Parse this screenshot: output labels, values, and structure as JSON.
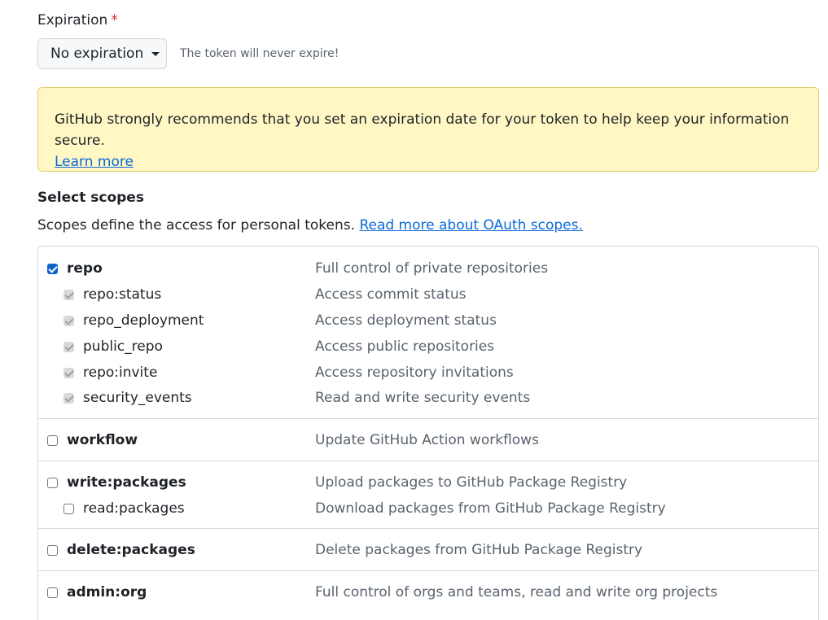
{
  "expiration": {
    "label": "Expiration",
    "required_mark": "*",
    "selected": "No expiration",
    "note": "The token will never expire!"
  },
  "flash": {
    "message": "GitHub strongly recommends that you set an expiration date for your token to help keep your information secure.",
    "link": "Learn more"
  },
  "scopes": {
    "title": "Select scopes",
    "description": "Scopes define the access for personal tokens.",
    "link": "Read more about OAuth scopes.",
    "items": [
      {
        "name": "repo",
        "desc": "Full control of private repositories",
        "checked": true
      },
      {
        "name": "repo:status",
        "desc": "Access commit status",
        "checked": true
      },
      {
        "name": "repo_deployment",
        "desc": "Access deployment status",
        "checked": true
      },
      {
        "name": "public_repo",
        "desc": "Access public repositories",
        "checked": true
      },
      {
        "name": "repo:invite",
        "desc": "Access repository invitations",
        "checked": true
      },
      {
        "name": "security_events",
        "desc": "Read and write security events",
        "checked": true
      },
      {
        "name": "workflow",
        "desc": "Update GitHub Action workflows",
        "checked": false
      },
      {
        "name": "write:packages",
        "desc": "Upload packages to GitHub Package Registry",
        "checked": false
      },
      {
        "name": "read:packages",
        "desc": "Download packages from GitHub Package Registry",
        "checked": false
      },
      {
        "name": "delete:packages",
        "desc": "Delete packages from GitHub Package Registry",
        "checked": false
      },
      {
        "name": "admin:org",
        "desc": "Full control of orgs and teams, read and write org projects",
        "checked": false
      }
    ]
  },
  "colors": {
    "accent": "#0b63ce",
    "link": "#0969da",
    "flash_bg": "#fff8c5",
    "required": "#d1242f"
  }
}
